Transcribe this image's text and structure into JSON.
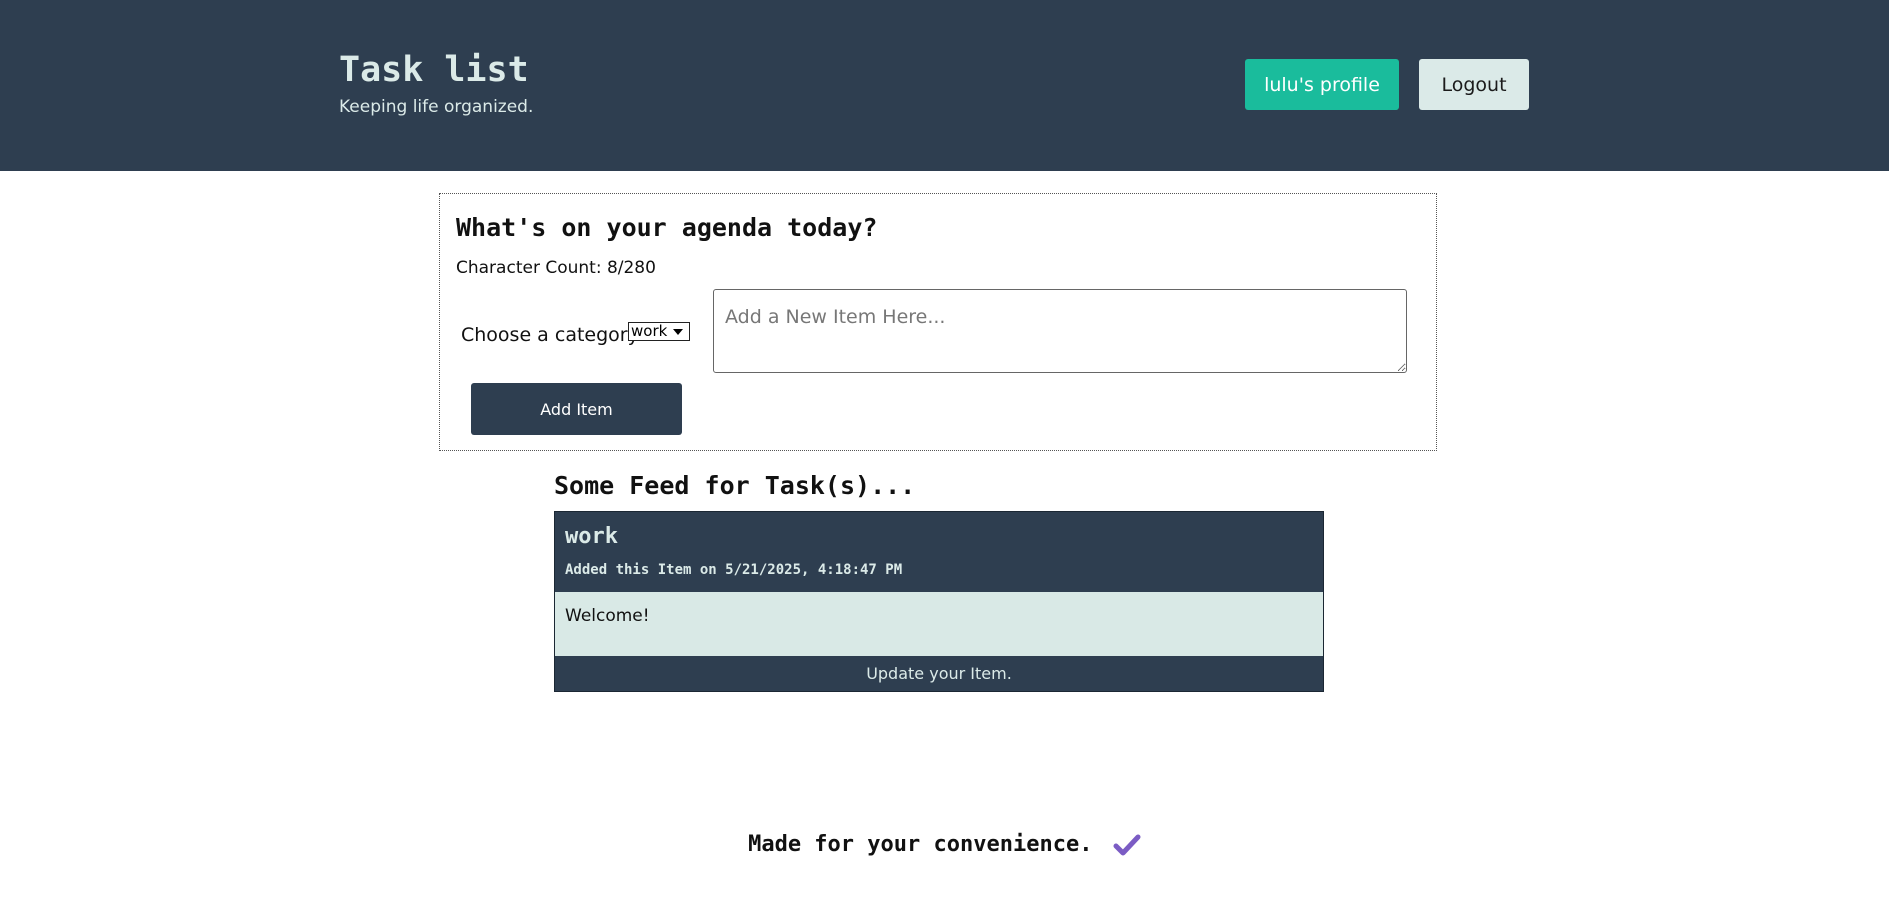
{
  "header": {
    "title": "Task list",
    "tagline": "Keeping life organized.",
    "profile_button": "lulu's profile",
    "logout_button": "Logout"
  },
  "composer": {
    "heading": "What's on your agenda today?",
    "char_count": "Character Count: 8/280",
    "category_label": "Choose a category:",
    "category_selected": "work",
    "item_placeholder": "Add a New Item Here...",
    "add_button": "Add Item"
  },
  "feed": {
    "heading": "Some Feed for Task(s)...",
    "items": [
      {
        "category": "work",
        "added_text": "Added this Item on 5/21/2025, 4:18:47 PM",
        "text": "Welcome!",
        "update_label": "Update your Item."
      }
    ]
  },
  "footer": {
    "text": "Made for your convenience.",
    "icon": "check-icon",
    "icon_color": "#7b5cc4"
  },
  "colors": {
    "header_bg": "#2e3e50",
    "accent": "#1abc9c",
    "light": "#dbeae8",
    "card_body_bg": "#d9e9e6"
  }
}
